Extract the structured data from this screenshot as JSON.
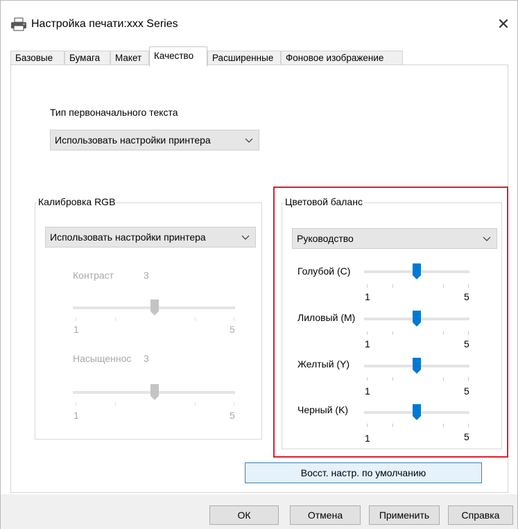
{
  "window": {
    "title": "Настройка печати:xxx Series",
    "close_symbol": "✕"
  },
  "tabs": [
    {
      "label": "Базовые"
    },
    {
      "label": "Бумага"
    },
    {
      "label": "Макет"
    },
    {
      "label": "Качество",
      "active": true
    },
    {
      "label": "Расширенные"
    },
    {
      "label": "Фоновое изображение"
    }
  ],
  "text_type": {
    "label": "Тип первоначального текста",
    "value": "Использовать настройки принтера"
  },
  "rgb_calibration": {
    "title": "Калибровка RGB",
    "dropdown_value": "Использовать настройки принтера",
    "contrast": {
      "label": "Контраст",
      "value": "3",
      "min": "1",
      "max": "5",
      "level": 3
    },
    "saturation": {
      "label": "Насыщеннос",
      "value": "3",
      "min": "1",
      "max": "5",
      "level": 3
    }
  },
  "color_balance": {
    "title": "Цветовой баланс",
    "dropdown_value": "Руководство",
    "sliders": [
      {
        "label": "Голубой (C)",
        "min": "1",
        "max": "5",
        "level": 3
      },
      {
        "label": "Лиловый (M)",
        "min": "1",
        "max": "5",
        "level": 3
      },
      {
        "label": "Желтый (Y)",
        "min": "1",
        "max": "5",
        "level": 3
      },
      {
        "label": "Черный (K)",
        "min": "1",
        "max": "5",
        "level": 3
      }
    ],
    "highlight_color": "#e01e2d"
  },
  "restore_defaults_label": "Восст. настр. по умолчанию",
  "footer": {
    "ok": "ОК",
    "cancel": "Отмена",
    "apply": "Применить",
    "help": "Справка"
  },
  "colors": {
    "accent": "#0078d7",
    "disabled_thumb": "#c4c4c4"
  },
  "icons": {
    "title": "printer-icon",
    "close": "close-icon",
    "dropdown": "chevron-down-icon"
  }
}
